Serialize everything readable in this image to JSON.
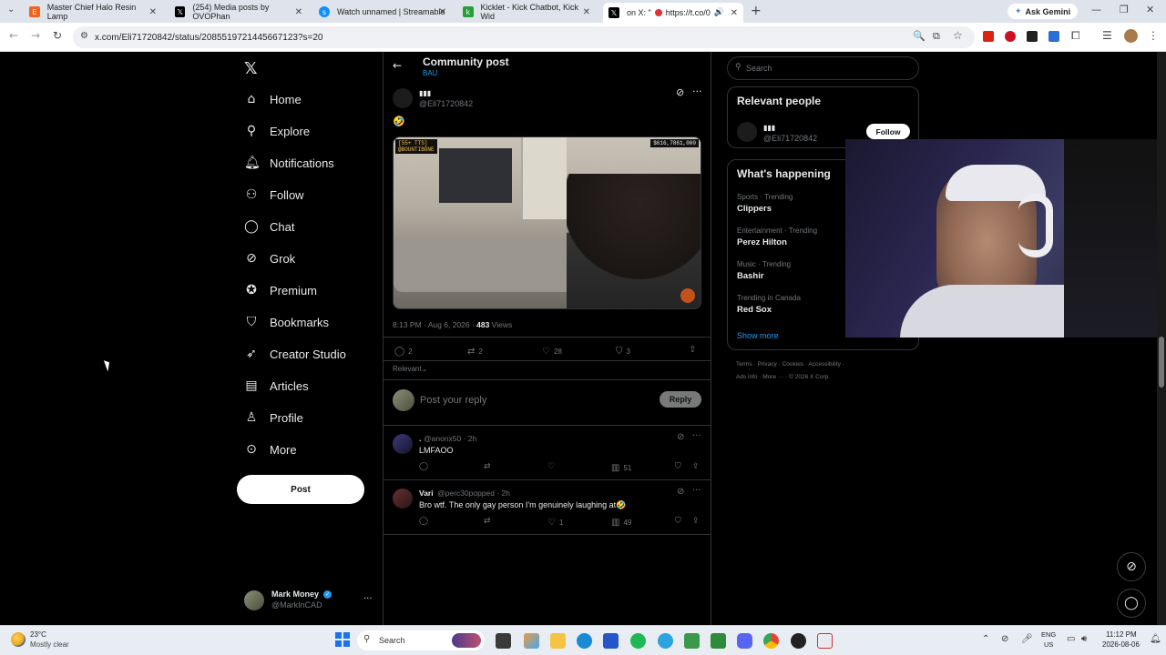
{
  "browser": {
    "tabs": [
      {
        "title": "Master Chief Halo Resin Lamp",
        "icon": "etsy-icon",
        "color": "#f1641e"
      },
      {
        "title": "(254) Media posts by OVOPhan",
        "icon": "x-icon",
        "color": "#000000"
      },
      {
        "title": "Watch unnamed | Streamable",
        "icon": "streamable-icon",
        "color": "#0f90fa"
      },
      {
        "title": "Kicklet - Kick Chatbot, Kick Wid",
        "icon": "kicklet-icon",
        "color": "#53fc18"
      },
      {
        "title": "on X: \"",
        "title_b": "https://t.co/0",
        "icon": "x-icon",
        "color": "#000000"
      }
    ],
    "new_tab": "+",
    "ask_gemini": "Ask Gemini",
    "url": "x.com/Eli71720842/status/2085519721445667123?s=20"
  },
  "nav": {
    "items": [
      {
        "label": "Home",
        "icon": "home-icon"
      },
      {
        "label": "Explore",
        "icon": "search-icon"
      },
      {
        "label": "Notifications",
        "icon": "bell-icon"
      },
      {
        "label": "Follow",
        "icon": "follow-icon"
      },
      {
        "label": "Chat",
        "icon": "chat-icon"
      },
      {
        "label": "Grok",
        "icon": "grok-icon"
      },
      {
        "label": "Premium",
        "icon": "premium-icon"
      },
      {
        "label": "Bookmarks",
        "icon": "bookmark-icon"
      },
      {
        "label": "Creator Studio",
        "icon": "rocket-icon"
      },
      {
        "label": "Articles",
        "icon": "article-icon"
      },
      {
        "label": "Profile",
        "icon": "profile-icon"
      },
      {
        "label": "More",
        "icon": "more-icon"
      }
    ],
    "post_button": "Post",
    "account_name": "Mark Money",
    "account_handle": "@MarkInCAD"
  },
  "main": {
    "header_title": "Community post",
    "header_sub": "BAU",
    "author_name": "▮▮▮",
    "author_handle": "@Eli71720842",
    "tweet_emoji": "🤣",
    "video_overlay_left": "[55+ TTS]",
    "video_overlay_left2": "@BOUNTIBONE",
    "video_overlay_right": "$616,7861,000",
    "meta_time": "8:13 PM · Aug 6, 2026 · ",
    "meta_views_count": "483",
    "meta_views_label": " Views",
    "stats": {
      "replies": "2",
      "reposts": "2",
      "likes": "28",
      "bookmarks": "3"
    },
    "sort_label": "Relevant",
    "reply_placeholder": "Post your reply",
    "reply_button": "Reply",
    "replies": [
      {
        "name": ".",
        "handle": "@anonx50 · 2h",
        "text": "LMFAOO",
        "likes": "",
        "views": "51"
      },
      {
        "name": "Vari",
        "handle": "@perc30popped · 2h",
        "text": "Bro wtf. The only gay person I'm genuinely laughing at🤣",
        "likes": "1",
        "views": "49"
      }
    ]
  },
  "right": {
    "search_placeholder": "Search",
    "relevant_title": "Relevant people",
    "relevant_name": "▮▮▮",
    "relevant_handle": "@Eli71720842",
    "follow_button": "Follow",
    "happening_title": "What's happening",
    "trends": [
      {
        "category": "Sports · Trending",
        "name": "Clippers"
      },
      {
        "category": "Entertainment · Trending",
        "name": "Perez Hilton"
      },
      {
        "category": "Music · Trending",
        "name": "Bashir"
      },
      {
        "category": "Trending in Canada",
        "name": "Red Sox"
      }
    ],
    "show_more": "Show more",
    "footer_line1": [
      "Terms",
      "Privacy",
      "Cookies",
      "Accessibility"
    ],
    "footer_line2": [
      "Ads info",
      "More ···",
      "© 2026 X Corp."
    ]
  },
  "taskbar": {
    "weather_temp": "23°C",
    "weather_desc": "Mostly clear",
    "search": "Search",
    "lang1": "ENG",
    "lang2": "US",
    "time": "11:12 PM",
    "date": "2026-08-06"
  },
  "colors": {
    "accent": "#1d9bf0",
    "background": "#000000",
    "border": "#2f3336"
  }
}
